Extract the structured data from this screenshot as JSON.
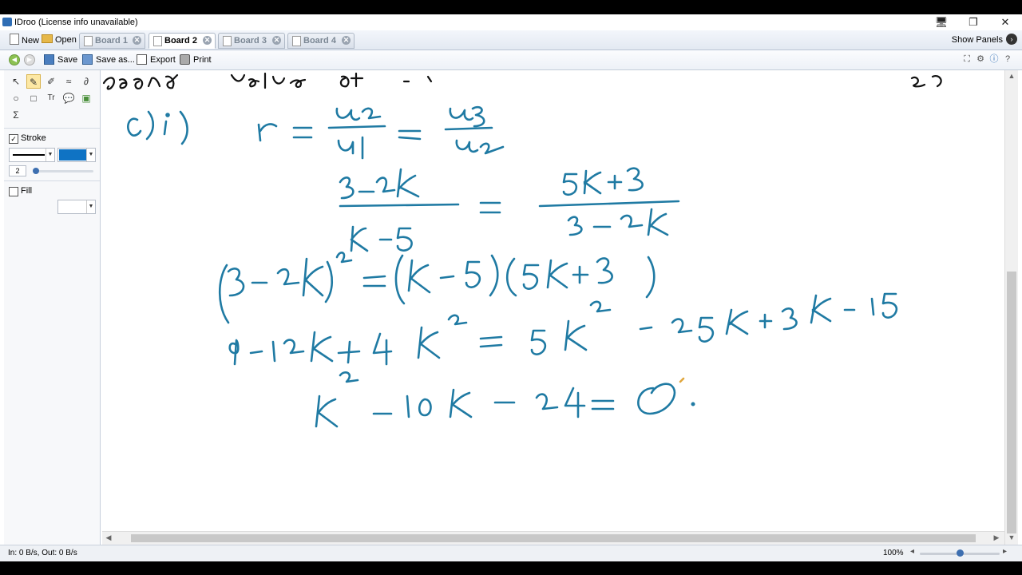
{
  "window": {
    "title": "IDroo (License info unavailable)"
  },
  "tabbar": {
    "new_label": "New",
    "open_label": "Open",
    "tabs": [
      {
        "label": "Board 1",
        "active": false
      },
      {
        "label": "Board 2",
        "active": true
      },
      {
        "label": "Board 3",
        "active": false
      },
      {
        "label": "Board 4",
        "active": false
      }
    ],
    "show_panels_label": "Show Panels"
  },
  "toolbar": {
    "save_label": "Save",
    "save_as_label": "Save as...",
    "export_label": "Export",
    "print_label": "Print"
  },
  "sidebar": {
    "stroke_label": "Stroke",
    "stroke_checked": true,
    "stroke_width": "2",
    "stroke_color": "#0f73c4",
    "fill_label": "Fill",
    "fill_checked": false
  },
  "statusbar": {
    "traffic": "In: 0 B/s, Out: 0 B/s",
    "zoom": "100%"
  },
  "colors": {
    "ink": "#1f7aa3",
    "accent": "#2f6eb5"
  }
}
